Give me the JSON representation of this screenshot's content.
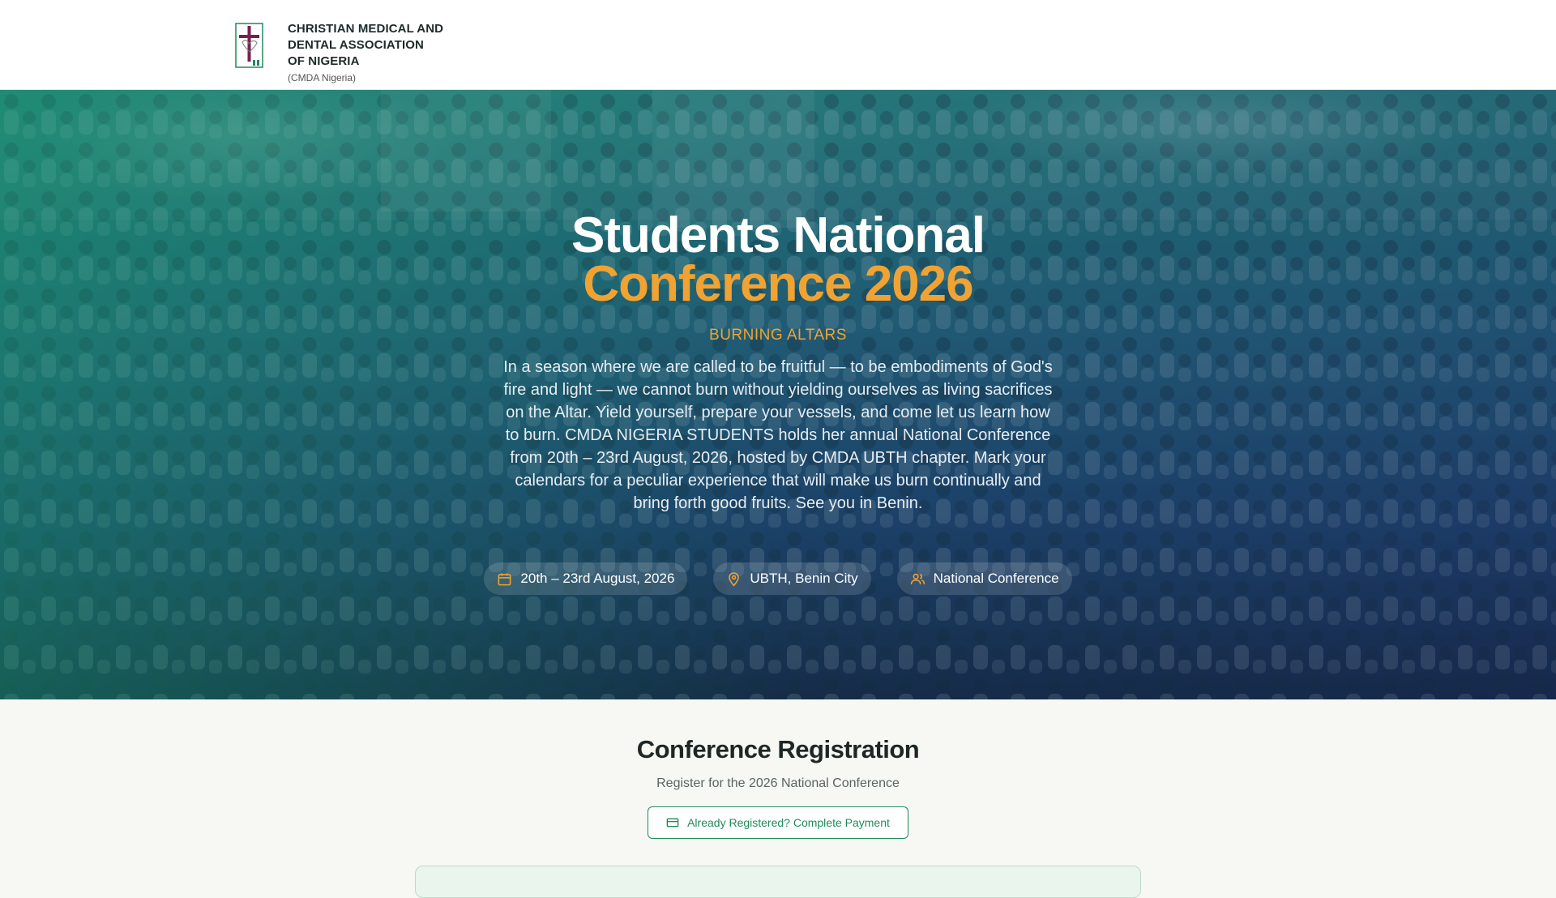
{
  "header": {
    "org_line1": "CHRISTIAN MEDICAL AND",
    "org_line2": "DENTAL ASSOCIATION",
    "org_line3": "OF NIGERIA",
    "org_short": "(CMDA Nigeria)"
  },
  "hero": {
    "title_line1": "Students National",
    "title_line2": "Conference 2026",
    "theme": "BURNING ALTARS",
    "description": "In a season where we are called to be fruitful — to be embodiments of God's fire and light — we cannot burn without yielding ourselves as living sacrifices on the Altar. Yield yourself, prepare your vessels, and come let us learn how to burn. CMDA NIGERIA STUDENTS holds her annual National Conference from 20th – 23rd August, 2026, hosted by CMDA UBTH chapter. Mark your calendars for a peculiar experience that will make us burn continually and bring forth good fruits. See you in Benin.",
    "chips": [
      {
        "icon": "calendar-icon",
        "label": "20th – 23rd August, 2026"
      },
      {
        "icon": "map-pin-icon",
        "label": "UBTH, Benin City"
      },
      {
        "icon": "users-icon",
        "label": "National Conference"
      }
    ]
  },
  "registration": {
    "title": "Conference Registration",
    "subtitle": "Register for the 2026 National Conference",
    "pay_button_label": "Already Registered? Complete Payment",
    "pay_button_icon": "credit-card-icon"
  },
  "colors": {
    "accent_orange": "#f0a332",
    "brand_green": "#1f8a5c",
    "hero_top": "#1d7c73",
    "hero_bottom": "#121d38"
  }
}
